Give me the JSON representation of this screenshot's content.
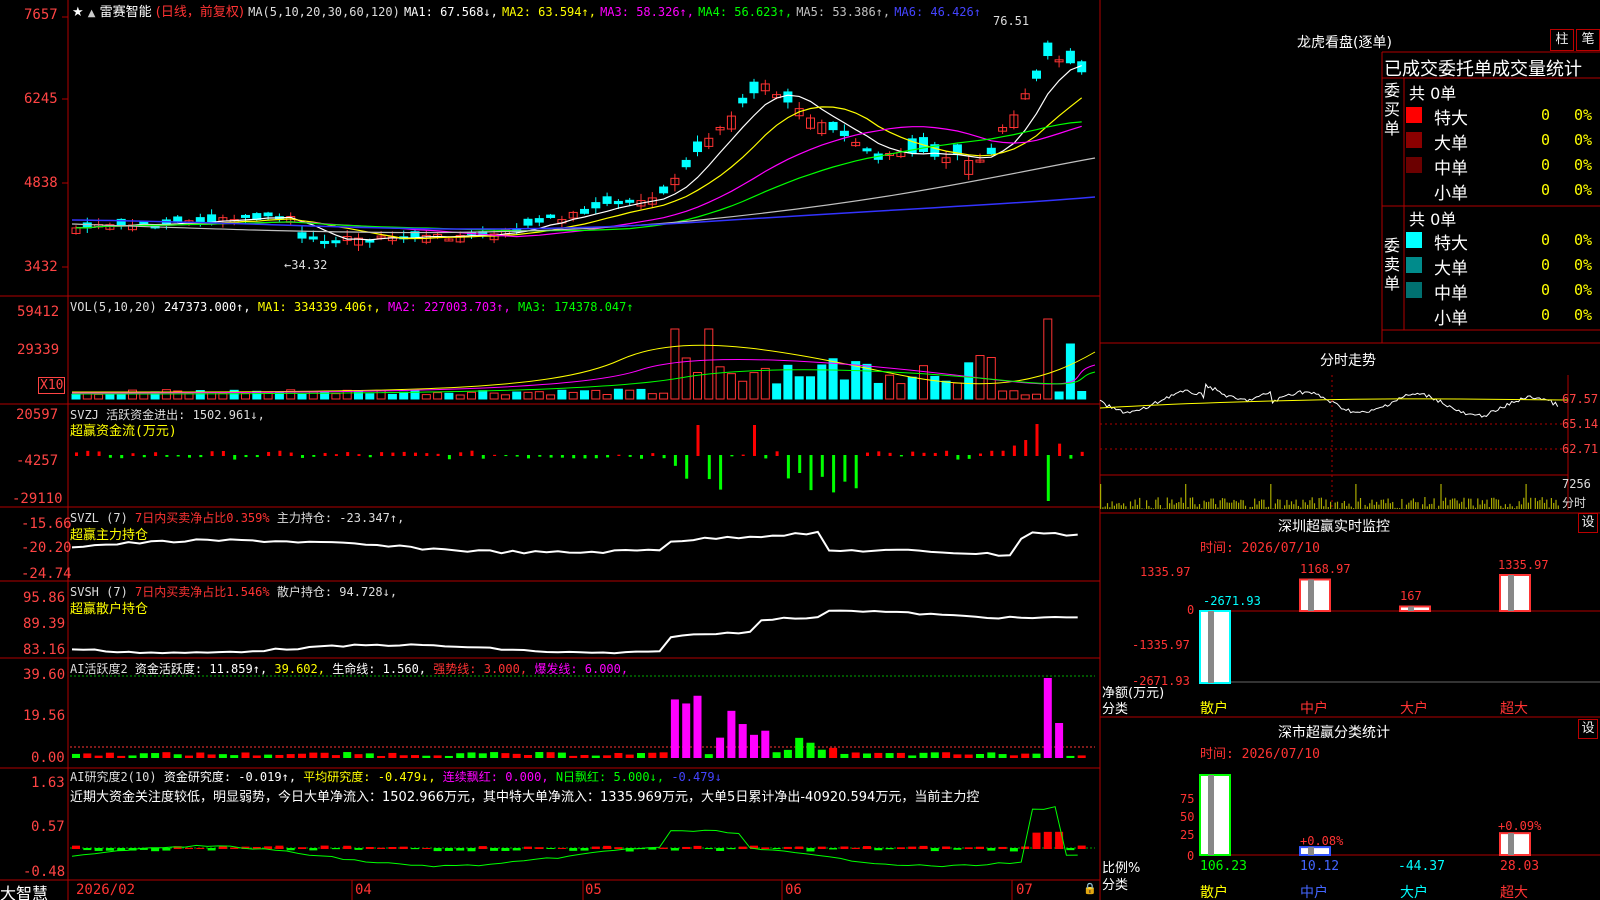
{
  "colors": {
    "up": "#ff3333",
    "down": "#00ffff",
    "grid": "#b00000",
    "ma1": "#ffffff",
    "ma2": "#ffff00",
    "ma3": "#ff00ff",
    "ma4": "#00ff00",
    "ma5": "#c0c0c0",
    "ma6": "#0000ff",
    "yellow": "#ffff00",
    "green": "#00ff00",
    "magenta": "#ff00ff"
  },
  "stock": {
    "name": "雷赛智能",
    "period": "(日线，前复权)",
    "ma_label": "MA(5,10,20,30,60,120)",
    "ma1": "MA1: 67.568↓,",
    "ma2": "MA2: 63.594↑,",
    "ma3": "MA3: 58.326↑,",
    "ma4": "MA4: 56.623↑,",
    "ma5": "MA5: 53.386↑,",
    "ma6": "MA6: 46.426↑",
    "high_mark": "76.51",
    "low_mark": "←34.32"
  },
  "axis": {
    "price": [
      "7657",
      "6245",
      "4838",
      "3432"
    ],
    "vol": [
      "59412",
      "29339",
      "X10"
    ],
    "svzj": [
      "20597",
      "-4257",
      "-29110"
    ],
    "svzl": [
      "-15.66",
      "-20.20",
      "-24.74"
    ],
    "svsh": [
      "95.86",
      "89.39",
      "83.16"
    ],
    "ai1": [
      "39.60",
      "19.56",
      "0.00"
    ],
    "ai2": [
      "1.63",
      "0.57",
      "-0.48"
    ],
    "dates": [
      "2026/02",
      "04",
      "05",
      "06",
      "07"
    ]
  },
  "panels": {
    "vol": {
      "head": "VOL(5,10,20)",
      "v": "247373.000↑,",
      "ma1": "MA1: 334339.406↑,",
      "ma2": "MA2: 227003.703↑,",
      "ma3": "MA3: 174378.047↑"
    },
    "svzj": {
      "head": "SVZJ",
      "title": "活跃资金进出: 1502.961↓,",
      "sub": "超赢资金流(万元)"
    },
    "svzl": {
      "head": "SVZL (7)",
      "a": "7日内买卖净占比0.359%",
      "b": "主力持仓: -23.347↑,",
      "sub": "超赢主力持仓"
    },
    "svsh": {
      "head": "SVSH (7)",
      "a": "7日内买卖净占比1.546%",
      "b": "散户持仓: 94.728↓,",
      "sub": "超赢散户持仓"
    },
    "ai1": {
      "head": "AI活跃度2",
      "a": "资金活跃度: 11.859↑,",
      "b": "39.602,",
      "c": "生命线: 1.560,",
      "d": "强势线: 3.000,",
      "e": "爆发线: 6.000,"
    },
    "ai2": {
      "head": "AI研究度2(10)",
      "a": "资金研究度: -0.019↑,",
      "b": "平均研究度: -0.479↓,",
      "c": "连续飘红: 0.000,",
      "d": "N日飘红: 5.000↓,",
      "e": "-0.479↓",
      "comment": "近期大资金关注度较低，明显弱势，今日大单净流入：1502.966万元，其中特大单净流入：1335.969万元，大单5日累计净出-40920.594万元，当前主力控"
    }
  },
  "brand": "大智慧",
  "right": {
    "lhb": {
      "title": "龙虎看盘(逐单)",
      "btn1": "柱",
      "btn2": "笔",
      "sub": "已成交委托单成交量统计",
      "buy": {
        "side": "委买单",
        "total": "共 0单",
        "rows": [
          {
            "label": "特大",
            "n": "0",
            "p": "0%",
            "color": "#ff0000"
          },
          {
            "label": "大单",
            "n": "0",
            "p": "0%",
            "color": "#8b0000"
          },
          {
            "label": "中单",
            "n": "0",
            "p": "0%",
            "color": "#6b0000"
          },
          {
            "label": "小单",
            "n": "0",
            "p": "0%",
            "color": ""
          }
        ]
      },
      "sell": {
        "side": "委卖单",
        "total": "共 0单",
        "rows": [
          {
            "label": "特大",
            "n": "0",
            "p": "0%",
            "color": "#00ffff"
          },
          {
            "label": "大单",
            "n": "0",
            "p": "0%",
            "color": "#008b8b"
          },
          {
            "label": "中单",
            "n": "0",
            "p": "0%",
            "color": "#007070"
          },
          {
            "label": "小单",
            "n": "0",
            "p": "0%",
            "color": ""
          }
        ]
      }
    },
    "fs": {
      "title": "分时走势",
      "y": [
        "67.57",
        "65.14",
        "62.71"
      ],
      "vol": "7256",
      "unit": "分时"
    },
    "monitor": {
      "title": "深圳超赢实时监控",
      "btn": "设",
      "time": "时间: 2026/07/10",
      "axis": [
        "1335.97",
        "0",
        "-1335.97",
        "-2671.93"
      ],
      "unit": "净额(万元)",
      "cls": "分类",
      "cats": [
        "散户",
        "中户",
        "大户",
        "超大"
      ],
      "values": [
        -2671.93,
        1168.97,
        167,
        1335.97
      ],
      "labels": [
        "-2671.93",
        "1168.97",
        "167",
        "1335.97"
      ]
    },
    "stats": {
      "title": "深市超赢分类统计",
      "btn": "设",
      "time": "时间: 2026/07/10",
      "axis": [
        "75",
        "50",
        "25",
        "0"
      ],
      "unit": "比例%",
      "cls": "分类",
      "cats": [
        "散户",
        "中户",
        "大户",
        "超大"
      ],
      "top": [
        "",
        "+0.08%",
        "",
        "+0.09%"
      ],
      "bottom": [
        "106.23",
        "10.12",
        "-44.37",
        "28.03"
      ],
      "heights": [
        106.23,
        10.12,
        0,
        28.03
      ]
    }
  }
}
